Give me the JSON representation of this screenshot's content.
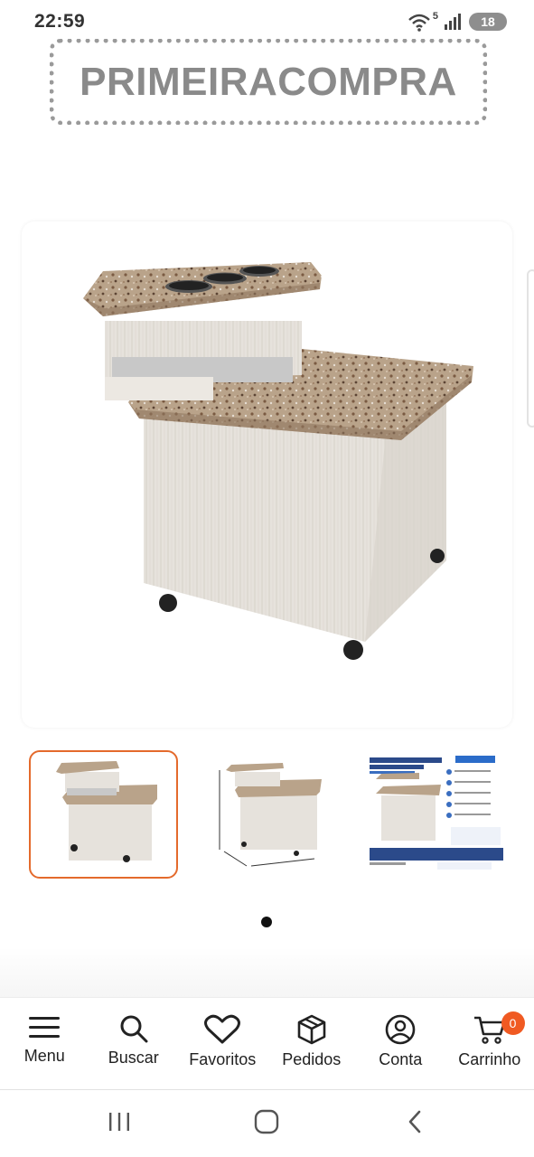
{
  "status_bar": {
    "time": "22:59",
    "battery": "18",
    "wifi_label": "5"
  },
  "coupon": {
    "code": "PRIMEIRACOMPRA"
  },
  "gallery": {
    "main_image": "marble-top cart with utensil holders",
    "thumbnails": [
      "cart-front",
      "cart-dimensions",
      "cart-spec-sheet"
    ],
    "selected_index": 0,
    "page_dots": 1
  },
  "bottom_nav": {
    "items": [
      {
        "label": "Menu",
        "icon": "menu-icon"
      },
      {
        "label": "Buscar",
        "icon": "search-icon"
      },
      {
        "label": "Favoritos",
        "icon": "heart-icon"
      },
      {
        "label": "Pedidos",
        "icon": "box-icon"
      },
      {
        "label": "Conta",
        "icon": "account-icon"
      },
      {
        "label": "Carrinho",
        "icon": "cart-icon"
      }
    ],
    "cart_count": "0"
  },
  "colors": {
    "accent": "#f05a22",
    "selected_border": "#e46a2c"
  }
}
